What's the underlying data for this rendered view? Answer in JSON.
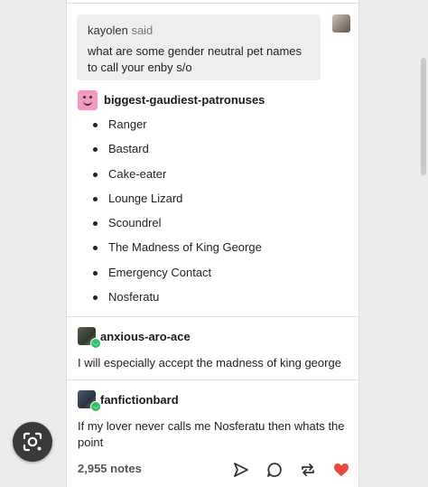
{
  "ask": {
    "username": "kayolen",
    "said_label": "said",
    "question": "what are some gender neutral pet names to call your enby s/o"
  },
  "reblog1": {
    "username": "biggest-gaudiest-patronuses",
    "items": [
      "Ranger",
      "Bastard",
      "Cake-eater",
      "Lounge Lizard",
      "Scoundrel",
      "The Madness of King George",
      "Emergency Contact",
      "Nosferatu"
    ]
  },
  "reblog2": {
    "username": "anxious-aro-ace",
    "comment": "I will especially accept the madness of king george"
  },
  "reblog3": {
    "username": "fanfictionbard",
    "comment": "If my lover never calls me Nosferatu then whats the point"
  },
  "footer": {
    "notes": "2,955 notes",
    "icons": [
      "share-icon",
      "reply-icon",
      "reblog-icon",
      "like-heart-icon"
    ]
  },
  "overlay": {
    "icon": "visual-search-lens-icon"
  },
  "colors": {
    "page_bg": "#ececec",
    "card_bg": "#ffffff",
    "ask_bg": "#eeeeee",
    "heart": "#e8483f",
    "badge_green": "#2cc46b",
    "avatar_pink": "#f49ac2"
  }
}
